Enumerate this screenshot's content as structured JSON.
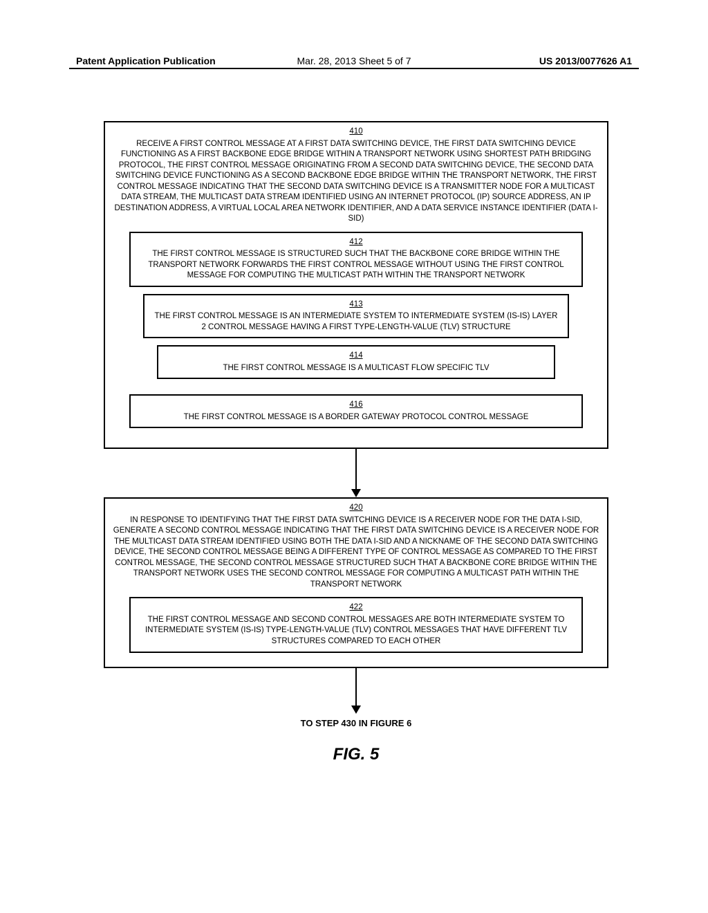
{
  "header": {
    "left": "Patent Application Publication",
    "center": "Mar. 28, 2013  Sheet 5 of 7",
    "right": "US 2013/0077626 A1"
  },
  "box410": {
    "ref": "410",
    "text": "RECEIVE A FIRST CONTROL MESSAGE AT A FIRST DATA SWITCHING DEVICE, THE FIRST DATA SWITCHING DEVICE FUNCTIONING AS A FIRST BACKBONE EDGE BRIDGE WITHIN A TRANSPORT NETWORK USING SHORTEST PATH BRIDGING PROTOCOL, THE FIRST CONTROL MESSAGE ORIGINATING FROM A SECOND DATA SWITCHING DEVICE, THE SECOND DATA SWITCHING DEVICE FUNCTIONING AS A SECOND BACKBONE EDGE BRIDGE WITHIN THE TRANSPORT NETWORK, THE FIRST CONTROL MESSAGE INDICATING THAT THE SECOND DATA SWITCHING DEVICE IS A TRANSMITTER NODE FOR A MULTICAST DATA STREAM, THE MULTICAST DATA STREAM IDENTIFIED USING AN INTERNET PROTOCOL (IP) SOURCE ADDRESS, AN IP DESTINATION ADDRESS, A VIRTUAL LOCAL AREA NETWORK IDENTIFIER, AND A DATA SERVICE INSTANCE IDENTIFIER (DATA I-SID)"
  },
  "box412": {
    "ref": "412",
    "text": "THE FIRST CONTROL MESSAGE IS STRUCTURED SUCH THAT THE BACKBONE CORE BRIDGE WITHIN THE TRANSPORT NETWORK FORWARDS THE FIRST CONTROL MESSAGE WITHOUT USING THE FIRST CONTROL MESSAGE FOR COMPUTING THE MULTICAST PATH WITHIN THE TRANSPORT NETWORK"
  },
  "box413": {
    "ref": "413",
    "text": "THE FIRST CONTROL MESSAGE IS AN INTERMEDIATE SYSTEM TO INTERMEDIATE SYSTEM (IS-IS) LAYER 2 CONTROL MESSAGE HAVING A FIRST TYPE-LENGTH-VALUE (TLV) STRUCTURE"
  },
  "box414": {
    "ref": "414",
    "text": "THE FIRST CONTROL MESSAGE IS A MULTICAST FLOW SPECIFIC TLV"
  },
  "box416": {
    "ref": "416",
    "text": "THE FIRST CONTROL MESSAGE IS A BORDER GATEWAY PROTOCOL CONTROL MESSAGE"
  },
  "box420": {
    "ref": "420",
    "text": "IN RESPONSE TO IDENTIFYING THAT THE FIRST DATA SWITCHING DEVICE IS A RECEIVER NODE FOR THE DATA I-SID, GENERATE A SECOND CONTROL MESSAGE INDICATING THAT THE FIRST DATA SWITCHING DEVICE IS A RECEIVER NODE FOR THE MULTICAST DATA STREAM IDENTIFIED USING BOTH THE DATA I-SID AND A NICKNAME OF THE SECOND DATA SWITCHING DEVICE, THE SECOND CONTROL MESSAGE BEING A DIFFERENT TYPE OF CONTROL MESSAGE AS COMPARED TO THE FIRST CONTROL MESSAGE, THE SECOND CONTROL MESSAGE STRUCTURED SUCH THAT A BACKBONE CORE BRIDGE WITHIN THE TRANSPORT NETWORK USES THE SECOND CONTROL MESSAGE FOR COMPUTING A MULTICAST PATH WITHIN THE TRANSPORT NETWORK"
  },
  "box422": {
    "ref": "422",
    "text": "THE FIRST CONTROL MESSAGE AND SECOND CONTROL MESSAGES ARE BOTH INTERMEDIATE SYSTEM TO INTERMEDIATE SYSTEM (IS-IS) TYPE-LENGTH-VALUE (TLV) CONTROL MESSAGES THAT HAVE DIFFERENT TLV STRUCTURES COMPARED TO EACH OTHER"
  },
  "footer": {
    "to_step": "TO STEP 430 IN FIGURE 6",
    "caption": "FIG. 5"
  }
}
